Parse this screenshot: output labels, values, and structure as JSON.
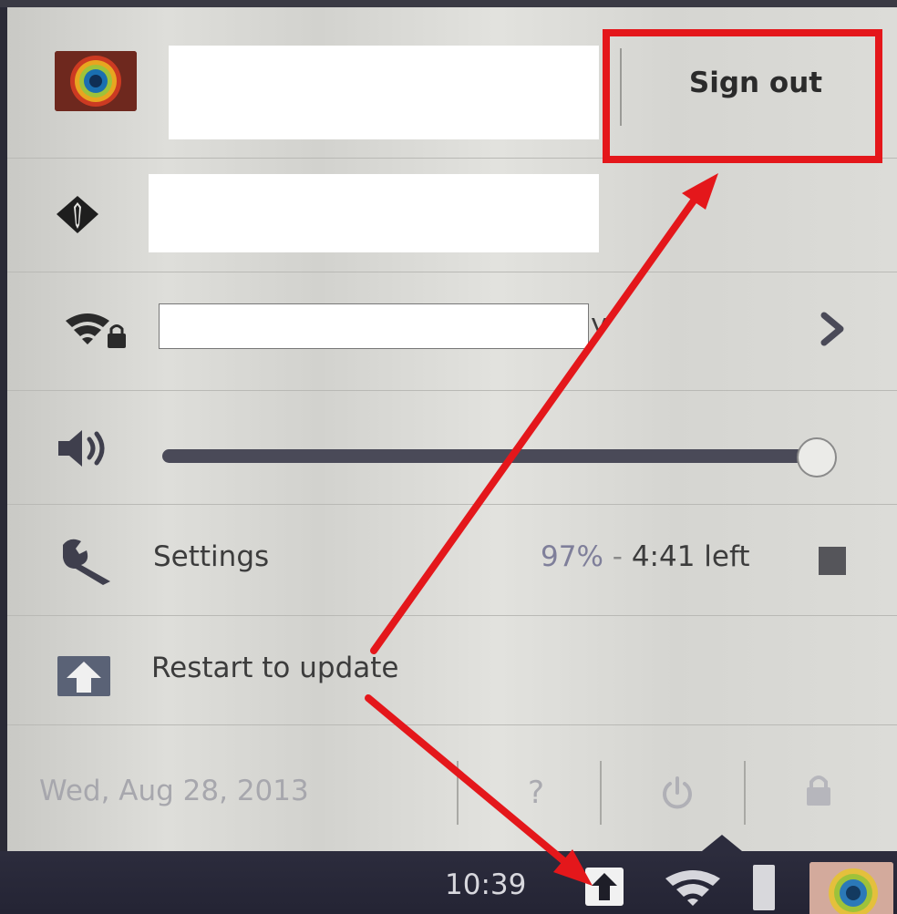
{
  "user_row": {
    "signout_label": "Sign out",
    "icon": "user-avatar"
  },
  "enterprise_row": {
    "icon": "enterprise-tie-icon"
  },
  "network_row": {
    "icon": "wifi-lock-icon",
    "chevron_icon": "chevron-right-icon",
    "visible_fragment": "y"
  },
  "volume_row": {
    "icon": "speaker-icon",
    "level": 1.0
  },
  "settings_row": {
    "label": "Settings",
    "icon": "wrench-icon",
    "battery_percent": "97%",
    "battery_separator": "-",
    "battery_time": "4:41 left"
  },
  "update_row": {
    "label": "Restart to update",
    "icon": "update-arrow-icon"
  },
  "footer": {
    "date": "Wed, Aug 28, 2013",
    "help_label": "?",
    "power_icon": "power-icon",
    "lock_icon": "lock-icon"
  },
  "shelf": {
    "clock": "10:39",
    "icons": [
      "update-arrow-icon",
      "wifi-icon",
      "battery-icon",
      "user-avatar"
    ]
  },
  "colors": {
    "highlight": "#e4171b",
    "panel_bg": "#d9d9d5",
    "shelf_bg": "#262635",
    "slider_track": "#4a4a58"
  }
}
